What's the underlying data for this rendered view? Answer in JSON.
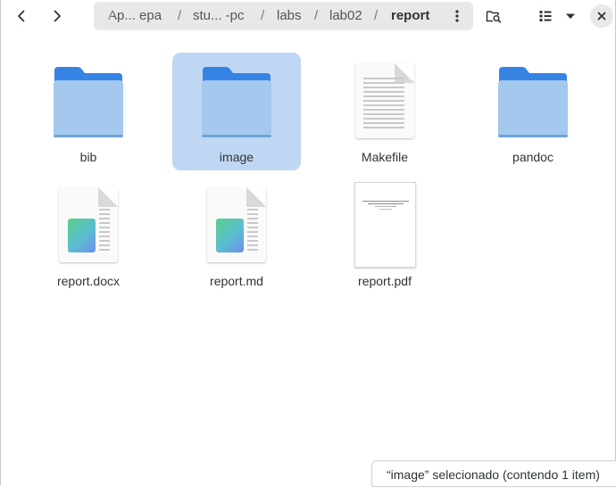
{
  "header": {
    "back_icon": "go-previous-icon",
    "forward_icon": "go-next-icon",
    "breadcrumbs": [
      {
        "label": "Ap... epa"
      },
      {
        "label": "stu... -pc"
      },
      {
        "label": "labs"
      },
      {
        "label": "lab02"
      },
      {
        "label": "report"
      }
    ],
    "separator": "/",
    "pathbar_menu_icon": "view-more-icon",
    "search_icon": "folder-search-icon",
    "view_icon": "view-list-icon",
    "view_menu_icon": "pan-down-icon",
    "close_icon": "window-close-icon"
  },
  "files": [
    {
      "name": "bib",
      "type": "folder"
    },
    {
      "name": "image",
      "type": "folder",
      "selected": true
    },
    {
      "name": "Makefile",
      "type": "text"
    },
    {
      "name": "pandoc",
      "type": "folder"
    },
    {
      "name": "report.docx",
      "type": "document"
    },
    {
      "name": "report.md",
      "type": "document"
    },
    {
      "name": "report.pdf",
      "type": "pdf"
    }
  ],
  "status": {
    "text": "“image” selecionado  (contendo 1 item)"
  },
  "colors": {
    "folder": "#3584e4",
    "folder_light": "#a4c8ee",
    "selection": "#c0d7f3",
    "pathbar_bg": "#e8e8e7"
  }
}
